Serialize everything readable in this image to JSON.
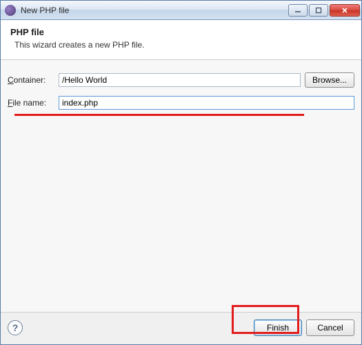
{
  "titlebar": {
    "title": "New PHP file"
  },
  "banner": {
    "heading": "PHP file",
    "description": "This wizard creates a new PHP file."
  },
  "form": {
    "container_label": "Container:",
    "container_value": "/Hello World",
    "browse_label": "Browse...",
    "filename_label": "File name:",
    "filename_value": "index.php"
  },
  "footer": {
    "finish_label": "Finish",
    "cancel_label": "Cancel"
  }
}
